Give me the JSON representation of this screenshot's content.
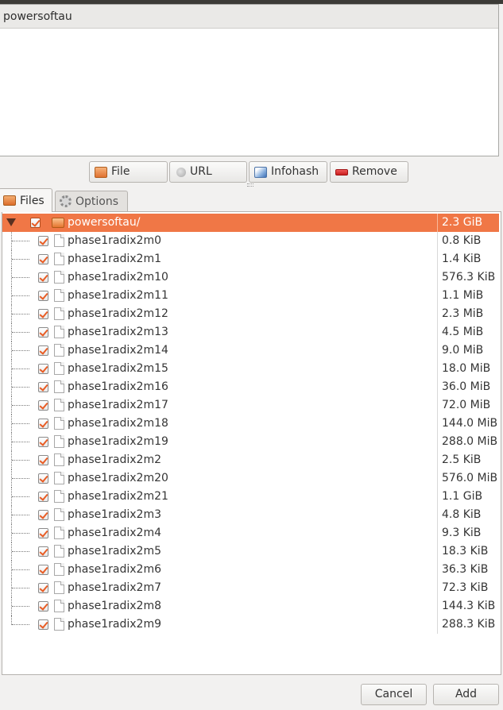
{
  "torrent_list": {
    "items": [
      "powersoftau"
    ]
  },
  "source_buttons": {
    "file": "File",
    "url": "URL",
    "infohash": "Infohash",
    "remove": "Remove"
  },
  "tabs": {
    "files": "Files",
    "options": "Options"
  },
  "file_tree": {
    "root": {
      "name": "powersoftau/",
      "size": "2.3 GiB",
      "checked": true
    },
    "files": [
      {
        "name": "phase1radix2m0",
        "size": "0.8 KiB"
      },
      {
        "name": "phase1radix2m1",
        "size": "1.4 KiB"
      },
      {
        "name": "phase1radix2m10",
        "size": "576.3 KiB"
      },
      {
        "name": "phase1radix2m11",
        "size": "1.1 MiB"
      },
      {
        "name": "phase1radix2m12",
        "size": "2.3 MiB"
      },
      {
        "name": "phase1radix2m13",
        "size": "4.5 MiB"
      },
      {
        "name": "phase1radix2m14",
        "size": "9.0 MiB"
      },
      {
        "name": "phase1radix2m15",
        "size": "18.0 MiB"
      },
      {
        "name": "phase1radix2m16",
        "size": "36.0 MiB"
      },
      {
        "name": "phase1radix2m17",
        "size": "72.0 MiB"
      },
      {
        "name": "phase1radix2m18",
        "size": "144.0 MiB"
      },
      {
        "name": "phase1radix2m19",
        "size": "288.0 MiB"
      },
      {
        "name": "phase1radix2m2",
        "size": "2.5 KiB"
      },
      {
        "name": "phase1radix2m20",
        "size": "576.0 MiB"
      },
      {
        "name": "phase1radix2m21",
        "size": "1.1 GiB"
      },
      {
        "name": "phase1radix2m3",
        "size": "4.8 KiB"
      },
      {
        "name": "phase1radix2m4",
        "size": "9.3 KiB"
      },
      {
        "name": "phase1radix2m5",
        "size": "18.3 KiB"
      },
      {
        "name": "phase1radix2m6",
        "size": "36.3 KiB"
      },
      {
        "name": "phase1radix2m7",
        "size": "72.3 KiB"
      },
      {
        "name": "phase1radix2m8",
        "size": "144.3 KiB"
      },
      {
        "name": "phase1radix2m9",
        "size": "288.3 KiB"
      }
    ]
  },
  "dialog_buttons": {
    "cancel": "Cancel",
    "add": "Add"
  },
  "colors": {
    "selection": "#f07746",
    "check_mark": "#e85c24"
  }
}
